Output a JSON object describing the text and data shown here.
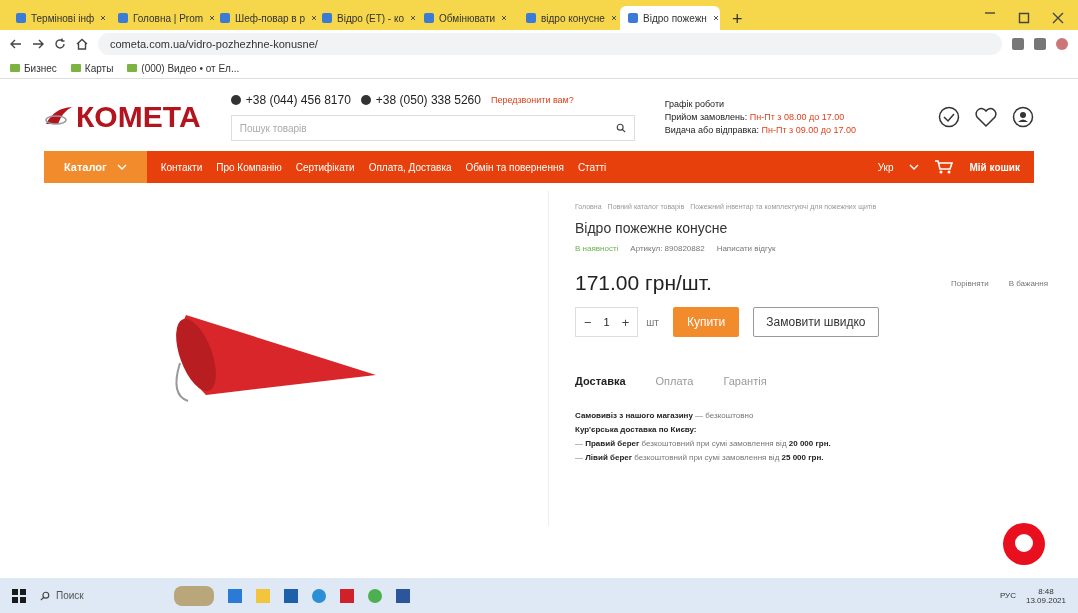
{
  "browser": {
    "tabs": [
      {
        "title": "Термінові інф",
        "selected": false
      },
      {
        "title": "Головна | Prom",
        "selected": false
      },
      {
        "title": "Шеф-повар в р",
        "selected": false
      },
      {
        "title": "Відро (ЕТ) - ко",
        "selected": false
      },
      {
        "title": "Обмінювати",
        "selected": false
      },
      {
        "title": "відро конусне",
        "selected": false
      },
      {
        "title": "Відро пожежн",
        "selected": true
      }
    ],
    "new_tab": "+",
    "url": "cometa.com.ua/vidro-pozhezhne-konusne/",
    "bookmarks": [
      "Бизнес",
      "Карты",
      "(000) Видео • от Ел..."
    ]
  },
  "header": {
    "logo": "КОМЕТА",
    "phones": [
      "+38 (044) 456 8170",
      "+38 (050) 338 5260"
    ],
    "callback_link": "Передзвонити вам?",
    "search": {
      "placeholder": "Пошук товарів"
    },
    "schedule_title": "Графік роботи",
    "schedule": [
      {
        "label": "Прийом замовлень:",
        "value": "Пн-Пт з 08.00 до 17.00"
      },
      {
        "label": "Видача або відправка:",
        "value": "Пн-Пт з 09.00 до 17.00"
      }
    ]
  },
  "nav": {
    "catalog": "Каталог",
    "items": [
      "Контакти",
      "Про Компанію",
      "Сертифікати",
      "Оплата, Доставка",
      "Обмін та повернення",
      "Статті"
    ],
    "language": "Укр",
    "cart": "Мій кошик"
  },
  "product": {
    "breadcrumbs": [
      "Головна",
      "Повний каталог товарів",
      "Пожежний інвентар та комплектуючі для пожежних щитів"
    ],
    "title": "Відро пожежне конусне",
    "availability": "В наявності",
    "sku": "Артикул: 890820882",
    "review_link": "Написати відгук",
    "price": "171.00 грн/шт.",
    "compare": "Порівняти",
    "wishlist": "В бажання",
    "quantity": {
      "minus": "−",
      "value": "1",
      "plus": "+",
      "unit": "шт"
    },
    "buy": "Купити",
    "quick_order": "Замовити швидко",
    "tabs": [
      {
        "label": "Доставка",
        "selected": true
      },
      {
        "label": "Оплата",
        "selected": false
      },
      {
        "label": "Гарантія",
        "selected": false
      }
    ],
    "delivery": [
      "**Самовивіз з нашого магазину** — безкоштовно",
      "**Кур'єрська доставка по Києву:**",
      "— **Правий берег** безкоштовний при сумі замовлення від **20 000 грн.**",
      "— **Лівий берег** безкоштовний при сумі замовлення від **25 000 грн.**"
    ]
  },
  "taskbar": {
    "search_placeholder": "Поиск",
    "language": "РУС",
    "time": "8:48",
    "date": "13.09.2021"
  }
}
